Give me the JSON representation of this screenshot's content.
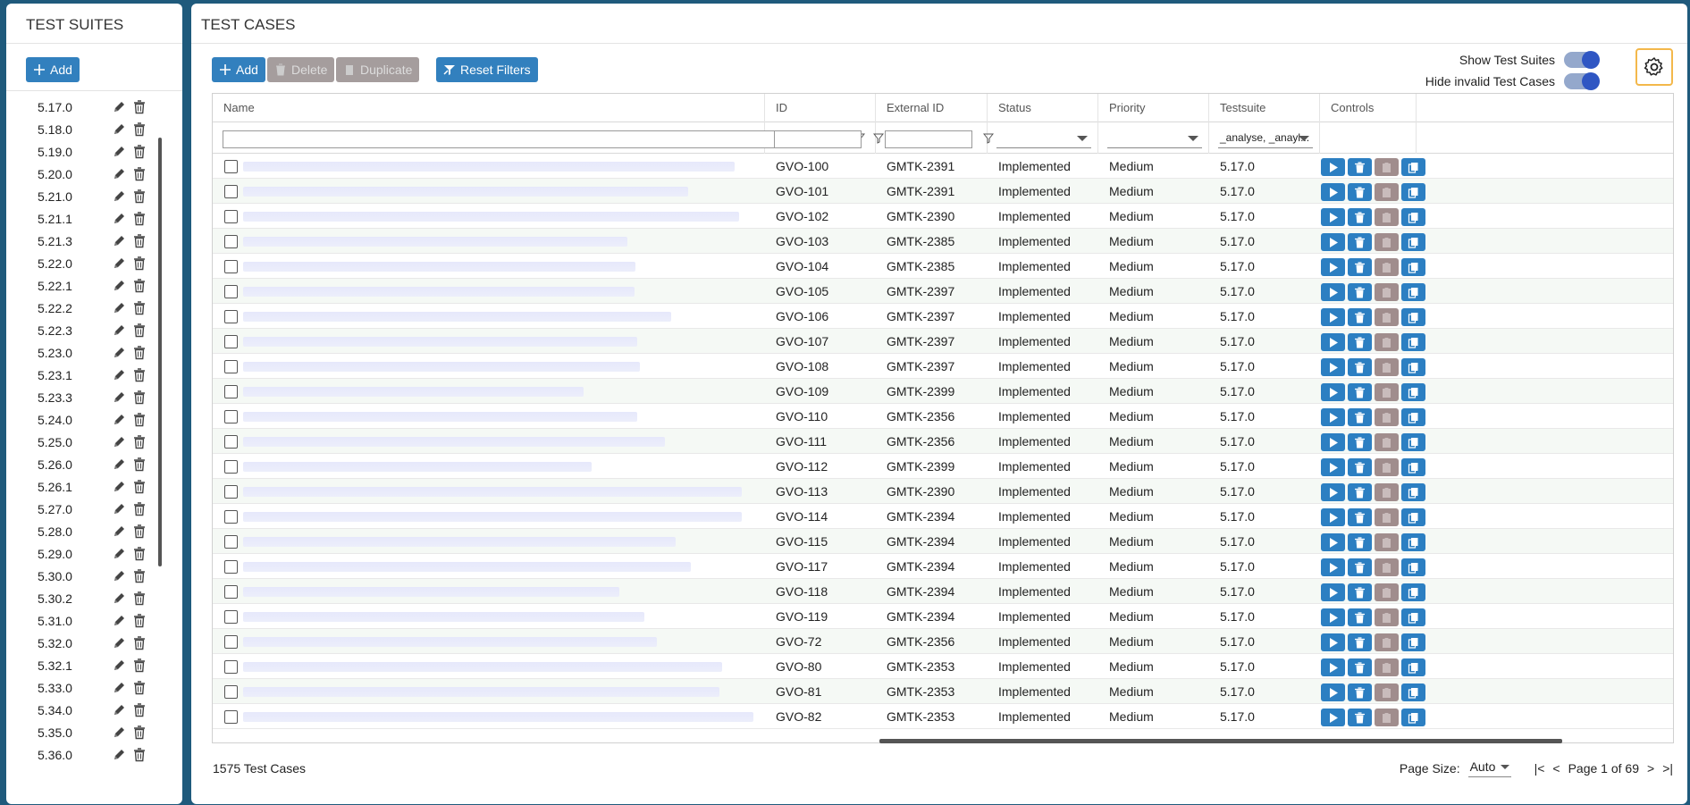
{
  "suites_panel": {
    "title": "TEST SUITES",
    "add_label": "Add",
    "items": [
      "5.17.0",
      "5.18.0",
      "5.19.0",
      "5.20.0",
      "5.21.0",
      "5.21.1",
      "5.21.3",
      "5.22.0",
      "5.22.1",
      "5.22.2",
      "5.22.3",
      "5.23.0",
      "5.23.1",
      "5.23.3",
      "5.24.0",
      "5.25.0",
      "5.26.0",
      "5.26.1",
      "5.27.0",
      "5.28.0",
      "5.29.0",
      "5.30.0",
      "5.30.2",
      "5.31.0",
      "5.32.0",
      "5.32.1",
      "5.33.0",
      "5.34.0",
      "5.35.0",
      "5.36.0"
    ]
  },
  "cases_panel": {
    "title": "TEST CASES",
    "toolbar": {
      "add_label": "Add",
      "delete_label": "Delete",
      "duplicate_label": "Duplicate",
      "reset_filters_label": "Reset Filters"
    },
    "toggles": {
      "show_suites_label": "Show Test Suites",
      "hide_invalid_label": "Hide invalid Test Cases"
    },
    "columns": {
      "name": "Name",
      "id": "ID",
      "external_id": "External ID",
      "status": "Status",
      "priority": "Priority",
      "testsuite": "Testsuite",
      "controls": "Controls"
    },
    "filters": {
      "testsuite_value": "_analyse, _anayl..."
    },
    "rows": [
      {
        "id": "GVO-100",
        "ext": "GMTK-2391",
        "status": "Implemented",
        "priority": "Medium",
        "suite": "5.17.0"
      },
      {
        "id": "GVO-101",
        "ext": "GMTK-2391",
        "status": "Implemented",
        "priority": "Medium",
        "suite": "5.17.0"
      },
      {
        "id": "GVO-102",
        "ext": "GMTK-2390",
        "status": "Implemented",
        "priority": "Medium",
        "suite": "5.17.0"
      },
      {
        "id": "GVO-103",
        "ext": "GMTK-2385",
        "status": "Implemented",
        "priority": "Medium",
        "suite": "5.17.0"
      },
      {
        "id": "GVO-104",
        "ext": "GMTK-2385",
        "status": "Implemented",
        "priority": "Medium",
        "suite": "5.17.0"
      },
      {
        "id": "GVO-105",
        "ext": "GMTK-2397",
        "status": "Implemented",
        "priority": "Medium",
        "suite": "5.17.0"
      },
      {
        "id": "GVO-106",
        "ext": "GMTK-2397",
        "status": "Implemented",
        "priority": "Medium",
        "suite": "5.17.0"
      },
      {
        "id": "GVO-107",
        "ext": "GMTK-2397",
        "status": "Implemented",
        "priority": "Medium",
        "suite": "5.17.0"
      },
      {
        "id": "GVO-108",
        "ext": "GMTK-2397",
        "status": "Implemented",
        "priority": "Medium",
        "suite": "5.17.0"
      },
      {
        "id": "GVO-109",
        "ext": "GMTK-2399",
        "status": "Implemented",
        "priority": "Medium",
        "suite": "5.17.0"
      },
      {
        "id": "GVO-110",
        "ext": "GMTK-2356",
        "status": "Implemented",
        "priority": "Medium",
        "suite": "5.17.0"
      },
      {
        "id": "GVO-111",
        "ext": "GMTK-2356",
        "status": "Implemented",
        "priority": "Medium",
        "suite": "5.17.0"
      },
      {
        "id": "GVO-112",
        "ext": "GMTK-2399",
        "status": "Implemented",
        "priority": "Medium",
        "suite": "5.17.0"
      },
      {
        "id": "GVO-113",
        "ext": "GMTK-2390",
        "status": "Implemented",
        "priority": "Medium",
        "suite": "5.17.0"
      },
      {
        "id": "GVO-114",
        "ext": "GMTK-2394",
        "status": "Implemented",
        "priority": "Medium",
        "suite": "5.17.0"
      },
      {
        "id": "GVO-115",
        "ext": "GMTK-2394",
        "status": "Implemented",
        "priority": "Medium",
        "suite": "5.17.0"
      },
      {
        "id": "GVO-117",
        "ext": "GMTK-2394",
        "status": "Implemented",
        "priority": "Medium",
        "suite": "5.17.0"
      },
      {
        "id": "GVO-118",
        "ext": "GMTK-2394",
        "status": "Implemented",
        "priority": "Medium",
        "suite": "5.17.0"
      },
      {
        "id": "GVO-119",
        "ext": "GMTK-2394",
        "status": "Implemented",
        "priority": "Medium",
        "suite": "5.17.0"
      },
      {
        "id": "GVO-72",
        "ext": "GMTK-2356",
        "status": "Implemented",
        "priority": "Medium",
        "suite": "5.17.0"
      },
      {
        "id": "GVO-80",
        "ext": "GMTK-2353",
        "status": "Implemented",
        "priority": "Medium",
        "suite": "5.17.0"
      },
      {
        "id": "GVO-81",
        "ext": "GMTK-2353",
        "status": "Implemented",
        "priority": "Medium",
        "suite": "5.17.0"
      },
      {
        "id": "GVO-82",
        "ext": "GMTK-2353",
        "status": "Implemented",
        "priority": "Medium",
        "suite": "5.17.0"
      }
    ],
    "footer": {
      "count_label": "1575 Test Cases",
      "page_size_label": "Page Size:",
      "page_size_value": "Auto",
      "first": "|<",
      "prev": "<",
      "page_info": "Page 1 of 69",
      "next": ">",
      "last": ">|"
    }
  },
  "colors": {
    "background": "#1f5a7c",
    "button_blue": "#3280be",
    "button_disabled": "#a59d9d",
    "toggle_knob": "#2f56c3",
    "settings_border": "#f3b84b"
  }
}
